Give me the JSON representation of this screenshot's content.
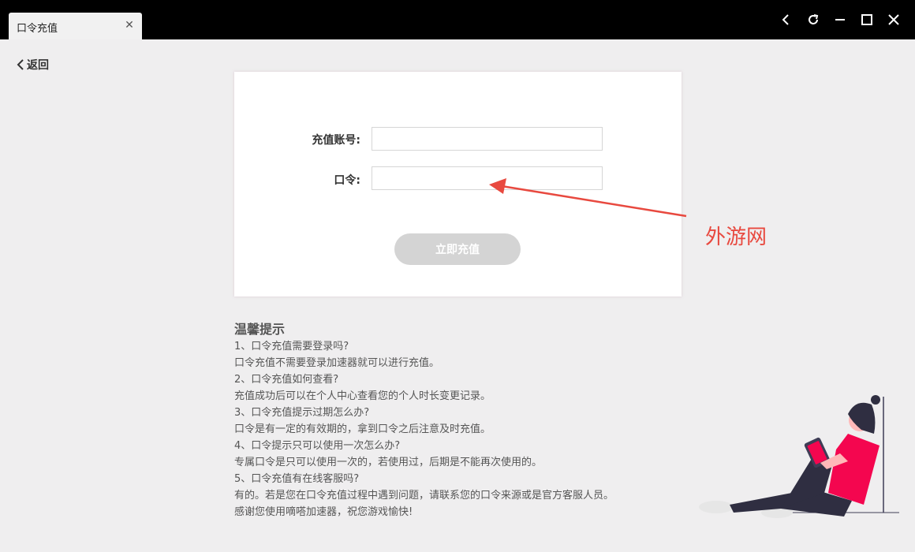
{
  "window": {
    "tab_title": "口令充值",
    "tab_close_icon": "close-icon",
    "controls": [
      "back-icon",
      "refresh-icon",
      "minimize-icon",
      "maximize-icon",
      "close-icon"
    ]
  },
  "nav": {
    "back_label": "返回"
  },
  "form": {
    "account_label": "充值账号:",
    "account_value": "",
    "code_label": "口令:",
    "code_value": "",
    "submit_label": "立即充值",
    "submit_color": "#d4d4d4"
  },
  "tips": {
    "title": "温馨提示",
    "lines": [
      "1、口令充值需要登录吗?",
      "口令充值不需要登录加速器就可以进行充值。",
      "2、口令充值如何查看?",
      "充值成功后可以在个人中心查看您的个人时长变更记录。",
      "3、口令充值提示过期怎么办?",
      "口令是有一定的有效期的，拿到口令之后注意及时充值。",
      "4、口令提示只可以使用一次怎么办?",
      "专属口令是只可以使用一次的，若使用过，后期是不能再次使用的。",
      "5、口令充值有在线客服吗?",
      "有的。若是您在口令充值过程中遇到问题，请联系您的口令来源或是官方客服人员。",
      "感谢您使用嘀嗒加速器，祝您游戏愉快!"
    ]
  },
  "annotation": {
    "text": "外游网",
    "color": "#e8493f"
  },
  "colors": {
    "titlebar": "#000000",
    "background": "#efeeef",
    "accent": "#f4064f"
  }
}
